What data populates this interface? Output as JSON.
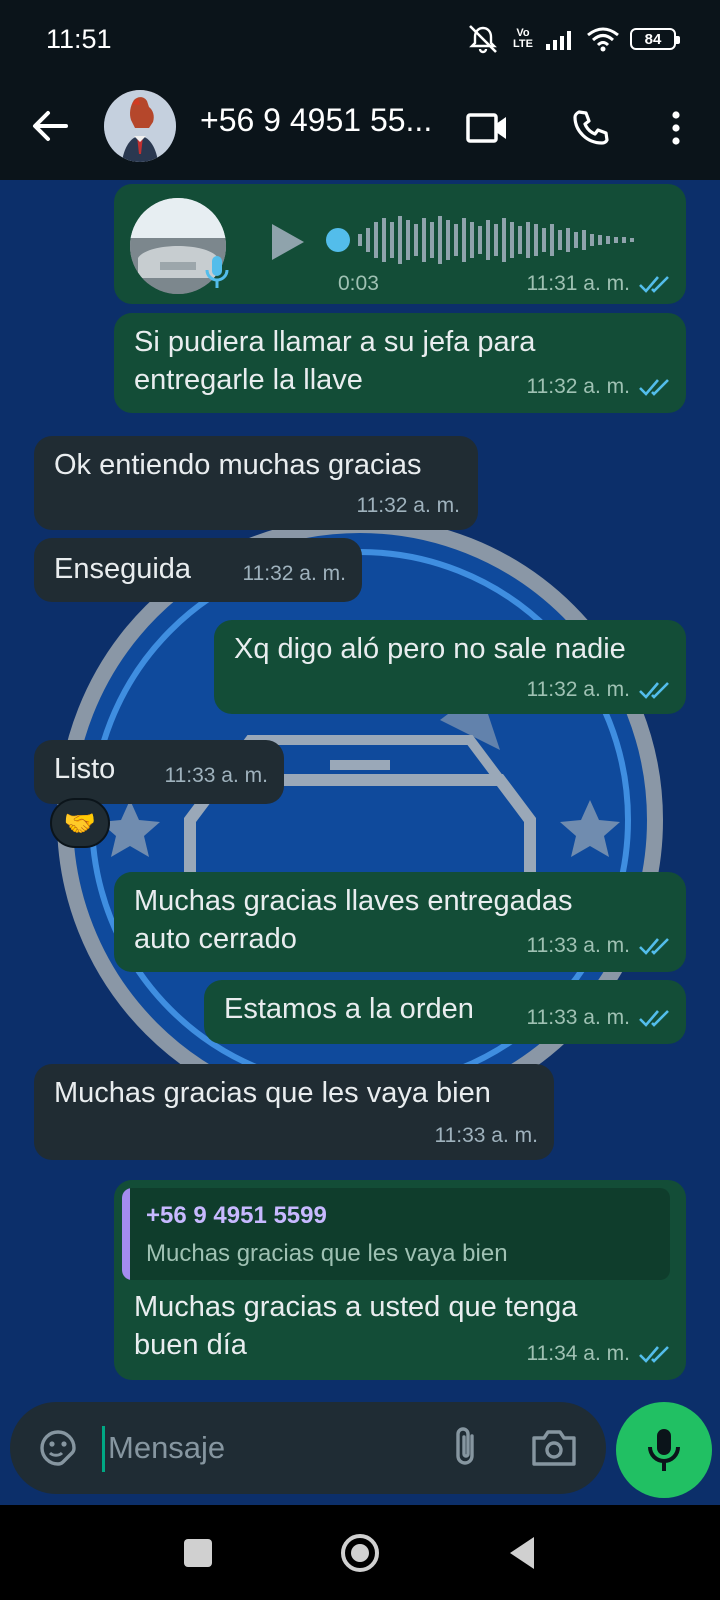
{
  "status_bar": {
    "time": "11:51",
    "network_label": "Vo LTE",
    "battery": "84"
  },
  "header": {
    "contact_name": "+56 9 4951 55..."
  },
  "messages": [
    {
      "id": "m0",
      "direction": "out",
      "type": "voice",
      "duration": "0:03",
      "time": "11:31 a. m."
    },
    {
      "id": "m1",
      "direction": "out",
      "text": "Si pudiera llamar a su jefa para entregarle la llave",
      "time": "11:32 a. m."
    },
    {
      "id": "m2",
      "direction": "in",
      "text": "Ok entiendo muchas gracias",
      "time": "11:32 a. m."
    },
    {
      "id": "m3",
      "direction": "in",
      "text": "Enseguida",
      "time": "11:32 a. m."
    },
    {
      "id": "m4",
      "direction": "out",
      "text": "Xq digo aló pero no sale nadie",
      "time": "11:32 a. m."
    },
    {
      "id": "m5",
      "direction": "in",
      "text": "Listo",
      "time": "11:33 a. m.",
      "reaction": "🤝"
    },
    {
      "id": "m6",
      "direction": "out",
      "text": "Muchas gracias llaves entregadas auto cerrado",
      "time": "11:33 a. m."
    },
    {
      "id": "m7",
      "direction": "out",
      "text": "Estamos a la orden",
      "time": "11:33 a. m."
    },
    {
      "id": "m8",
      "direction": "in",
      "text": "Muchas gracias que les vaya bien",
      "time": "11:33 a. m."
    },
    {
      "id": "m9",
      "direction": "out",
      "quote": {
        "author": "+56 9 4951 5599",
        "text": "Muchas gracias que les vaya bien"
      },
      "text": "Muchas gracias a usted que tenga buen día",
      "time": "11:34 a. m."
    }
  ],
  "composer": {
    "placeholder": "Mensaje"
  },
  "icons": {
    "back": "arrow-left-icon",
    "video": "video-call-icon",
    "call": "phone-icon",
    "menu": "more-vertical-icon",
    "sticker": "sticker-icon",
    "attach": "paperclip-icon",
    "camera": "camera-icon",
    "mic": "microphone-icon"
  },
  "colors": {
    "outgoing_bubble": "#134d37",
    "incoming_bubble": "#202c33",
    "read_ticks": "#53bdeb",
    "mic_button": "#21c063",
    "wallpaper": "#0c2f6a"
  }
}
